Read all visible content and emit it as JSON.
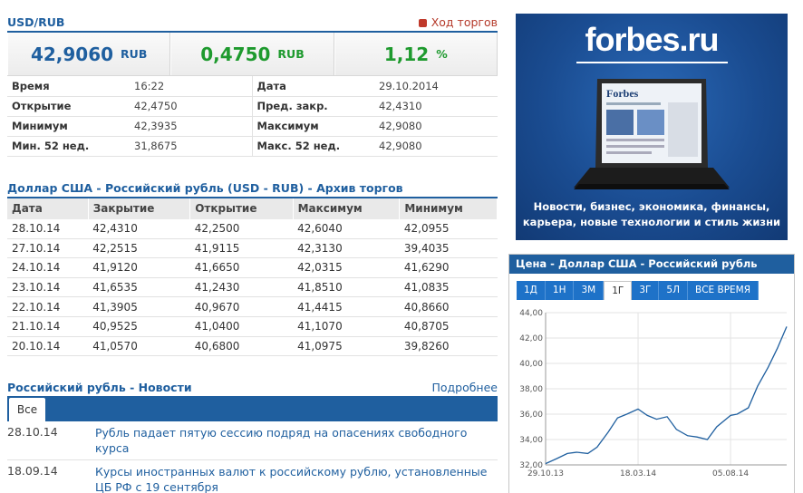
{
  "quote": {
    "pair": "USD/RUB",
    "live_link": "Ход торгов",
    "price": "42,9060",
    "price_unit": "RUB",
    "change": "0,4750",
    "change_unit": "RUB",
    "change_pct": "1,12",
    "change_pct_unit": "%"
  },
  "stats": [
    {
      "l1": "Время",
      "v1": "16:22",
      "l2": "Дата",
      "v2": "29.10.2014"
    },
    {
      "l1": "Открытие",
      "v1": "42,4750",
      "l2": "Пред. закр.",
      "v2": "42,4310"
    },
    {
      "l1": "Минимум",
      "v1": "42,3935",
      "l2": "Максимум",
      "v2": "42,9080"
    },
    {
      "l1": "Мин. 52 нед.",
      "v1": "31,8675",
      "l2": "Макс. 52 нед.",
      "v2": "42,9080"
    }
  ],
  "archive": {
    "title": "Доллар США - Российский рубль (USD - RUB) - Архив торгов",
    "headers": [
      "Дата",
      "Закрытие",
      "Открытие",
      "Максимум",
      "Минимум"
    ],
    "rows": [
      [
        "28.10.14",
        "42,4310",
        "42,2500",
        "42,6040",
        "42,0955"
      ],
      [
        "27.10.14",
        "42,2515",
        "41,9115",
        "42,3130",
        "39,4035"
      ],
      [
        "24.10.14",
        "41,9120",
        "41,6650",
        "42,0315",
        "41,6290"
      ],
      [
        "23.10.14",
        "41,6535",
        "41,2430",
        "41,8510",
        "41,0835"
      ],
      [
        "22.10.14",
        "41,3905",
        "40,9670",
        "41,4415",
        "40,8660"
      ],
      [
        "21.10.14",
        "40,9525",
        "41,0400",
        "41,1070",
        "40,8705"
      ],
      [
        "20.10.14",
        "41,0570",
        "40,6800",
        "41,0975",
        "39,8260"
      ]
    ]
  },
  "news": {
    "title": "Российский рубль - Новости",
    "more": "Подробнее",
    "tab": "Все",
    "items": [
      {
        "date": "28.10.14",
        "text": "Рубль падает пятую сессию подряд на опасениях свободного курса"
      },
      {
        "date": "18.09.14",
        "text": "Курсы иностранных валют к российскому рублю, установленные ЦБ РФ с 19 сентября"
      }
    ]
  },
  "ad": {
    "logo": "forbes.ru",
    "screen_logo": "Forbes",
    "text1": "Новости, бизнес, экономика, финансы,",
    "text2": "карьера, новые технологии и стиль жизни"
  },
  "chart_panel": {
    "title": "Цена - Доллар США - Российский рубль",
    "buttons": [
      "1Д",
      "1Н",
      "3М",
      "1Г",
      "3Г",
      "5Л",
      "ВСЕ ВРЕМЯ"
    ],
    "active": "1Г"
  },
  "colors": {
    "accent": "#1f5f9f",
    "up": "#1e9a2e",
    "link_red": "#b53a2a"
  },
  "chart_data": {
    "type": "line",
    "xlabels": [
      "29.10.13",
      "18.03.14",
      "05.08.14"
    ],
    "ylabels": [
      "32,00",
      "34,00",
      "36,00",
      "38,00",
      "40,00",
      "42,00",
      "44,00"
    ],
    "ylim": [
      32,
      44
    ],
    "x_first": "29.10.13",
    "x_last": "29.10.14",
    "x": [
      "29.10.13",
      "15.11.13",
      "01.12.13",
      "15.12.13",
      "01.01.14",
      "15.01.14",
      "01.02.14",
      "15.02.14",
      "01.03.14",
      "18.03.14",
      "01.04.14",
      "15.04.14",
      "01.05.14",
      "15.05.14",
      "01.06.14",
      "15.06.14",
      "01.07.14",
      "15.07.14",
      "05.08.14",
      "15.08.14",
      "01.09.14",
      "15.09.14",
      "01.10.14",
      "15.10.14",
      "29.10.14"
    ],
    "values": [
      32.1,
      32.5,
      32.9,
      33.0,
      32.9,
      33.4,
      34.6,
      35.7,
      36.0,
      36.4,
      35.9,
      35.6,
      35.8,
      34.8,
      34.3,
      34.2,
      34.0,
      35.0,
      35.9,
      36.0,
      36.5,
      38.2,
      39.7,
      41.2,
      42.9
    ],
    "grid": true
  }
}
